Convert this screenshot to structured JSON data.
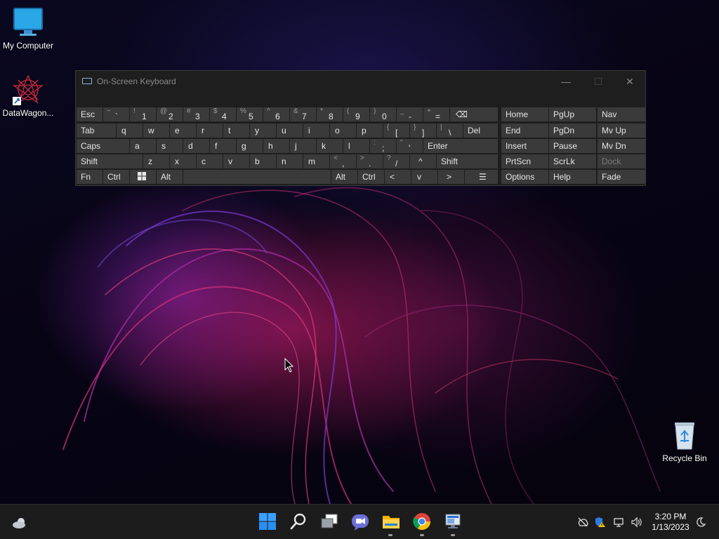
{
  "desktop": {
    "icons": [
      {
        "label": "My Computer",
        "icon": "monitor-icon"
      },
      {
        "label": "DataWagon...",
        "icon": "datawagon-shortcut-icon"
      },
      {
        "label": "Recycle Bin",
        "icon": "recycle-bin-icon"
      }
    ]
  },
  "osk": {
    "title": "On-Screen Keyboard",
    "window_buttons": {
      "minimize": "—",
      "maximize": "☐",
      "close": "✕"
    },
    "row1": {
      "esc": "Esc",
      "tilde": {
        "sec": "~",
        "pri": "`"
      },
      "k1": {
        "sec": "!",
        "pri": "1"
      },
      "k2": {
        "sec": "@",
        "pri": "2"
      },
      "k3": {
        "sec": "#",
        "pri": "3"
      },
      "k4": {
        "sec": "$",
        "pri": "4"
      },
      "k5": {
        "sec": "%",
        "pri": "5"
      },
      "k6": {
        "sec": "^",
        "pri": "6"
      },
      "k7": {
        "sec": "&",
        "pri": "7"
      },
      "k8": {
        "sec": "*",
        "pri": "8"
      },
      "k9": {
        "sec": "(",
        "pri": "9"
      },
      "k0": {
        "sec": ")",
        "pri": "0"
      },
      "minus": {
        "sec": "_",
        "pri": "-"
      },
      "equals": {
        "sec": "+",
        "pri": "="
      },
      "backspace": "⌫"
    },
    "row2": {
      "tab": "Tab",
      "letters": [
        "q",
        "w",
        "e",
        "r",
        "t",
        "y",
        "u",
        "i",
        "o",
        "p"
      ],
      "lbracket": {
        "sec": "{",
        "pri": "["
      },
      "rbracket": {
        "sec": "}",
        "pri": "]"
      },
      "backslash": {
        "sec": "|",
        "pri": "\\"
      },
      "del": "Del"
    },
    "row3": {
      "caps": "Caps",
      "letters": [
        "a",
        "s",
        "d",
        "f",
        "g",
        "h",
        "j",
        "k",
        "l"
      ],
      "semicolon": {
        "sec": ":",
        "pri": ";"
      },
      "quote": {
        "sec": "\"",
        "pri": "'"
      },
      "enter": "Enter"
    },
    "row4": {
      "shift_left": "Shift",
      "letters": [
        "z",
        "x",
        "c",
        "v",
        "b",
        "n",
        "m"
      ],
      "comma": {
        "sec": "<",
        "pri": ","
      },
      "period": {
        "sec": ">",
        "pri": "."
      },
      "slash": {
        "sec": "?",
        "pri": "/"
      },
      "up": "^",
      "shift_right": "Shift"
    },
    "row5": {
      "fn": "Fn",
      "ctrl_left": "Ctrl",
      "win": "windows-logo-icon",
      "alt_left": "Alt",
      "alt_right": "Alt",
      "ctrl_right": "Ctrl",
      "left": "<",
      "down": "v",
      "right": ">",
      "menu": "☰"
    },
    "nav_block": {
      "home": "Home",
      "pgup": "PgUp",
      "nav": "Nav",
      "end": "End",
      "pgdn": "PgDn",
      "mvup": "Mv Up",
      "insert": "Insert",
      "pause": "Pause",
      "mvdn": "Mv Dn",
      "prtscn": "PrtScn",
      "scrlk": "ScrLk",
      "dock": "Dock",
      "options": "Options",
      "help": "Help",
      "fade": "Fade"
    }
  },
  "taskbar": {
    "apps": [
      "weather-icon",
      "start-icon",
      "search-icon",
      "task-view-icon",
      "chat-icon",
      "file-explorer-icon",
      "chrome-icon",
      "remote-desktop-icon"
    ],
    "tray": [
      "network-off-icon",
      "security-warning-icon",
      "display-icon",
      "volume-icon",
      "focus-moon-icon"
    ],
    "time": "3:20 PM",
    "date": "1/13/2023"
  },
  "colors": {
    "osk_bg": "#1e1e1e",
    "key_bg": "#3a3a3a",
    "taskbar_bg": "#1c1c1c",
    "accent_blue": "#3b8fd9"
  }
}
